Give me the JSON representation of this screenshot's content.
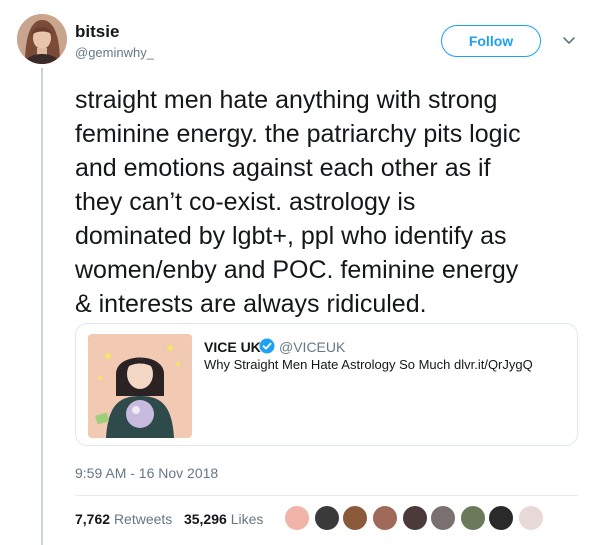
{
  "author": {
    "name": "bitsie",
    "handle": "@geminwhy_"
  },
  "follow_label": "Follow",
  "tweet": {
    "lines": [
      "straight men hate anything with strong",
      "feminine energy. the patriarchy pits logic",
      "and emotions against each other as if",
      "they can’t co-exist. astrology is",
      "dominated by lgbt+, ppl who identify as",
      "women/enby and POC. feminine energy",
      "& interests are always ridiculed."
    ]
  },
  "quoted": {
    "name": "VICE UK",
    "handle": "@VICEUK",
    "text": "Why Straight Men Hate Astrology So Much dlvr.it/QrJygQ"
  },
  "timestamp": "9:59 AM - 16 Nov 2018",
  "stats": {
    "retweets_count": "7,762",
    "retweets_label": "Retweets",
    "likes_count": "35,296",
    "likes_label": "Likes"
  },
  "colors": {
    "accent": "#1da1f2",
    "muted": "#657786",
    "border": "#e1e8ed"
  },
  "icons": [
    "chevron-down-icon",
    "verified-badge-icon"
  ]
}
